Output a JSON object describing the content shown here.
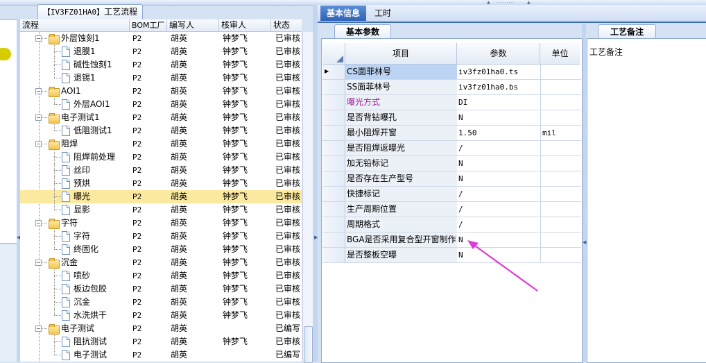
{
  "tree_tab": {
    "code": "【IV3FZ01HA0】",
    "label": "工艺流程"
  },
  "tree_columns": [
    "流程",
    "BOM工厂",
    "编写人",
    "核审人",
    "状态"
  ],
  "tree_rows": [
    {
      "name": "外层蚀刻1",
      "bom": "P2",
      "writer": "胡英",
      "reviewer": "钟梦飞",
      "status": "已审核"
    },
    {
      "name": "退膜1",
      "bom": "P2",
      "writer": "胡英",
      "reviewer": "钟梦飞",
      "status": "已审核"
    },
    {
      "name": "碱性蚀刻1",
      "bom": "P2",
      "writer": "胡英",
      "reviewer": "钟梦飞",
      "status": "已审核"
    },
    {
      "name": "退锡1",
      "bom": "P2",
      "writer": "胡英",
      "reviewer": "钟梦飞",
      "status": "已审核"
    },
    {
      "name": "AOI1",
      "bom": "P2",
      "writer": "胡英",
      "reviewer": "钟梦飞",
      "status": "已审核"
    },
    {
      "name": "外层AOI1",
      "bom": "P2",
      "writer": "胡英",
      "reviewer": "钟梦飞",
      "status": "已审核"
    },
    {
      "name": "电子测试1",
      "bom": "P2",
      "writer": "胡英",
      "reviewer": "钟梦飞",
      "status": "已审核"
    },
    {
      "name": "低阻测试1",
      "bom": "P2",
      "writer": "胡英",
      "reviewer": "钟梦飞",
      "status": "已审核"
    },
    {
      "name": "阻焊",
      "bom": "P2",
      "writer": "胡英",
      "reviewer": "钟梦飞",
      "status": "已审核"
    },
    {
      "name": "阻焊前处理",
      "bom": "P2",
      "writer": "胡英",
      "reviewer": "钟梦飞",
      "status": "已审核"
    },
    {
      "name": "丝印",
      "bom": "P2",
      "writer": "胡英",
      "reviewer": "钟梦飞",
      "status": "已审核"
    },
    {
      "name": "预烘",
      "bom": "P2",
      "writer": "胡英",
      "reviewer": "钟梦飞",
      "status": "已审核"
    },
    {
      "name": "曝光",
      "bom": "P2",
      "writer": "胡英",
      "reviewer": "钟梦飞",
      "status": "已审核"
    },
    {
      "name": "显影",
      "bom": "P2",
      "writer": "胡英",
      "reviewer": "钟梦飞",
      "status": "已审核"
    },
    {
      "name": "字符",
      "bom": "P2",
      "writer": "胡英",
      "reviewer": "钟梦飞",
      "status": "已审核"
    },
    {
      "name": "字符",
      "bom": "P2",
      "writer": "胡英",
      "reviewer": "钟梦飞",
      "status": "已审核"
    },
    {
      "name": "终固化",
      "bom": "P2",
      "writer": "胡英",
      "reviewer": "钟梦飞",
      "status": "已审核"
    },
    {
      "name": "沉金",
      "bom": "P2",
      "writer": "胡英",
      "reviewer": "钟梦飞",
      "status": "已审核"
    },
    {
      "name": "喷砂",
      "bom": "P2",
      "writer": "胡英",
      "reviewer": "钟梦飞",
      "status": "已审核"
    },
    {
      "name": "板边包胶",
      "bom": "P2",
      "writer": "胡英",
      "reviewer": "钟梦飞",
      "status": "已审核"
    },
    {
      "name": "沉金",
      "bom": "P2",
      "writer": "胡英",
      "reviewer": "钟梦飞",
      "status": "已审核"
    },
    {
      "name": "水洗烘干",
      "bom": "P2",
      "writer": "胡英",
      "reviewer": "钟梦飞",
      "status": "已审核"
    },
    {
      "name": "电子测试",
      "bom": "P2",
      "writer": "胡英",
      "reviewer": "",
      "status": "已编写"
    },
    {
      "name": "阻抗测试",
      "bom": "P2",
      "writer": "胡英",
      "reviewer": "钟梦飞",
      "status": "已审核"
    },
    {
      "name": "电子测试",
      "bom": "P2",
      "writer": "胡英",
      "reviewer": "",
      "status": "已编写"
    }
  ],
  "tabs": {
    "basic_info": "基本信息",
    "work_hours": "工时"
  },
  "subtabs": {
    "basic_params": "基本参数",
    "process_notes": "工艺备注"
  },
  "grid_columns": {
    "item": "项目",
    "param": "参数",
    "unit": "单位"
  },
  "grid_rows": [
    {
      "item": "CS面菲林号",
      "param": "iv3fz01ha0.ts",
      "unit": ""
    },
    {
      "item": "SS面菲林号",
      "param": "iv3fz01ha0.bs",
      "unit": ""
    },
    {
      "item": "曝光方式",
      "param": "DI",
      "unit": ""
    },
    {
      "item": "是否背钻曝孔",
      "param": "N",
      "unit": ""
    },
    {
      "item": "最小阻焊开窗",
      "param": "1.50",
      "unit": "mil"
    },
    {
      "item": "是否阻焊返曝光",
      "param": "/",
      "unit": ""
    },
    {
      "item": "加无铅标记",
      "param": "N",
      "unit": ""
    },
    {
      "item": "是否存在生产型号",
      "param": "N",
      "unit": ""
    },
    {
      "item": "快捷标记",
      "param": "/",
      "unit": ""
    },
    {
      "item": "生产周期位置",
      "param": "/",
      "unit": ""
    },
    {
      "item": "周期格式",
      "param": "/",
      "unit": ""
    },
    {
      "item": "BGA是否采用复合型开窗制作",
      "param": "N",
      "unit": ""
    },
    {
      "item": "是否整板空曝",
      "param": "N",
      "unit": ""
    }
  ],
  "notes_label": "工艺备注",
  "colors": {
    "accent": "#2e62b3",
    "selection": "#fce9a0",
    "annotation_arrow": "#e03ad8",
    "highlight_text": "#a0209a"
  }
}
